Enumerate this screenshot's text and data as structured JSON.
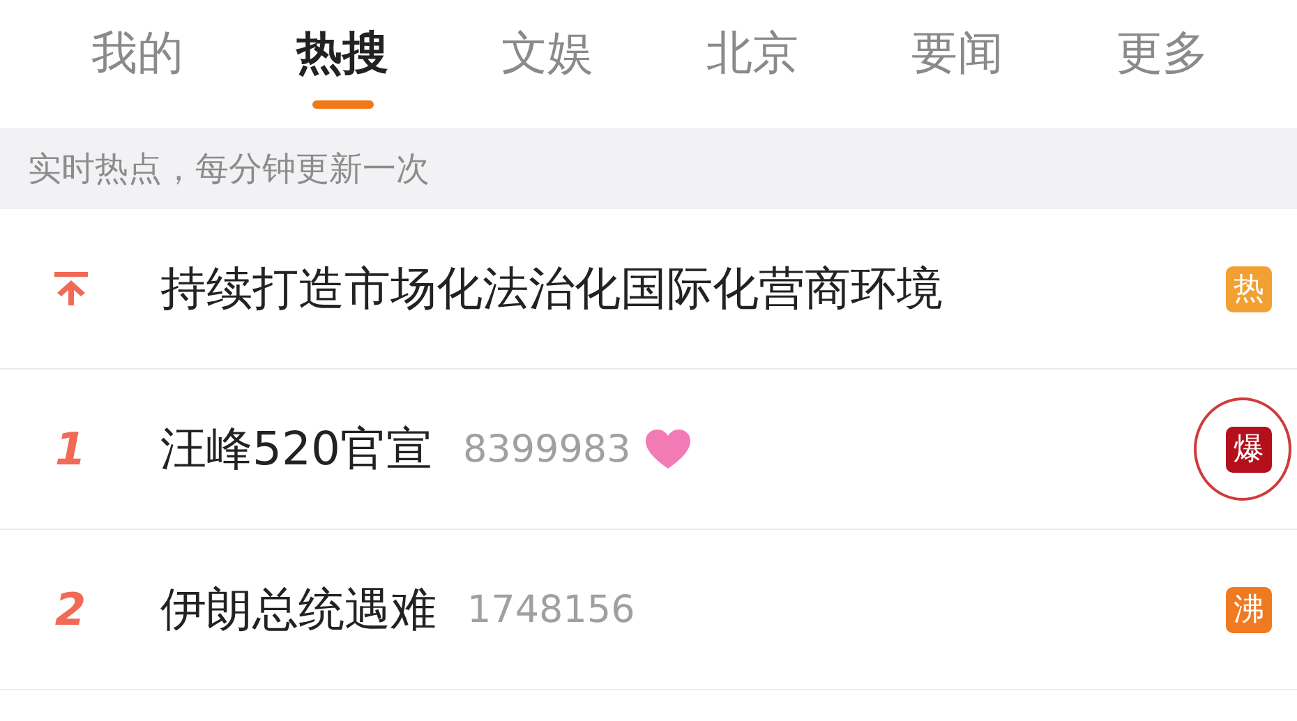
{
  "tabs": [
    {
      "label": "我的",
      "selected": false
    },
    {
      "label": "热搜",
      "selected": true
    },
    {
      "label": "文娱",
      "selected": false
    },
    {
      "label": "北京",
      "selected": false
    },
    {
      "label": "要闻",
      "selected": false
    },
    {
      "label": "更多",
      "selected": false
    }
  ],
  "notice": "实时热点，每分钟更新一次",
  "rows": [
    {
      "kind": "pinned",
      "title": "持续打造市场化法治化国际化营商环境",
      "badge": {
        "label": "热",
        "color": "#f2a031"
      },
      "circled": false
    },
    {
      "kind": "number",
      "rank": "1",
      "title": "汪峰520官宣",
      "count": "8399983",
      "emoji": true,
      "badge": {
        "label": "爆",
        "color": "#b3101c"
      },
      "circled": true
    },
    {
      "kind": "number",
      "rank": "2",
      "title": "伊朗总统遇难",
      "count": "1748156",
      "badge": {
        "label": "沸",
        "color": "#f07a22"
      },
      "circled": false
    }
  ]
}
